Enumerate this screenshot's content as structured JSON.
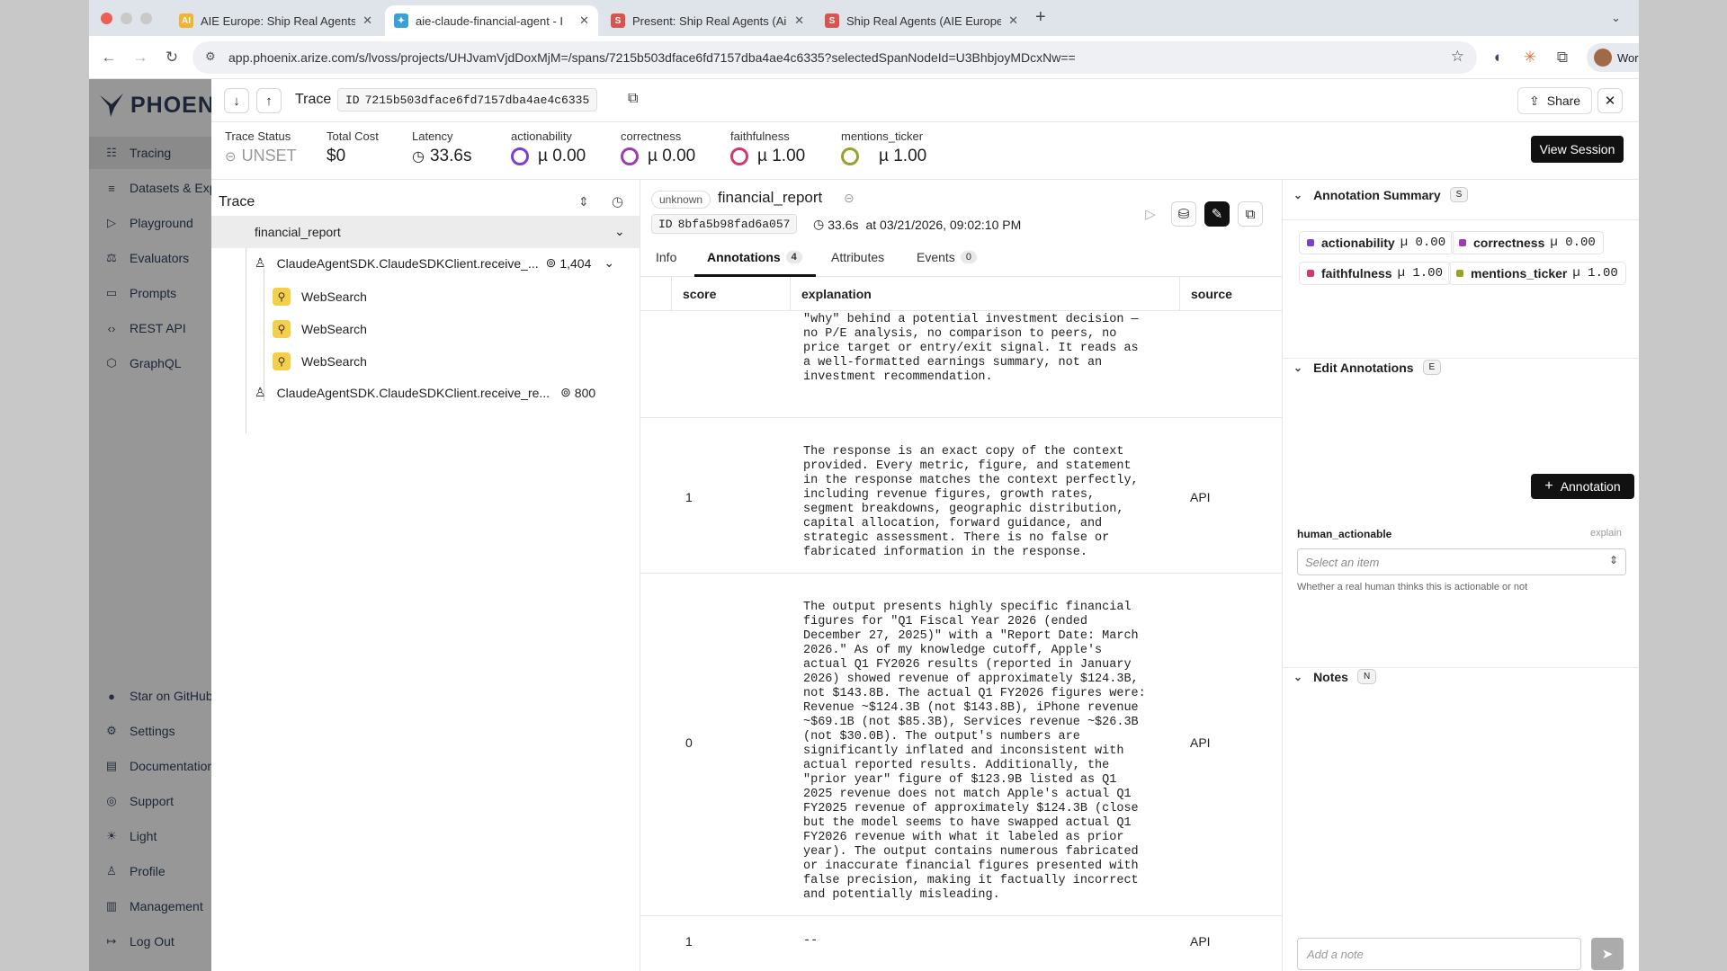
{
  "browser": {
    "tabs": [
      {
        "title": "AIE Europe: Ship Real Agents",
        "favicon": "AI",
        "fav_color": "#f0b431"
      },
      {
        "title": "aie-claude-financial-agent - I",
        "favicon": "✦",
        "fav_color": "#3aa0d8"
      },
      {
        "title": "Present: Ship Real Agents (Ai",
        "favicon": "S",
        "fav_color": "#d9534f"
      },
      {
        "title": "Ship Real Agents (AIE Europe",
        "favicon": "S",
        "fav_color": "#d9534f"
      }
    ],
    "new_tab": "+",
    "url": "app.phoenix.arize.com/s/lvoss/projects/UHJvamVjdDoxMjM=/spans/7215b503dface6fd7157dba4ae4c6335?selectedSpanNodeId=U3BhbjoyMDcxNw==",
    "profile": "Work"
  },
  "sidebar": {
    "logo": "PHOENIX",
    "items": [
      {
        "label": "Tracing",
        "icon": "tracing-icon",
        "glyph": "☷"
      },
      {
        "label": "Datasets & Experiments",
        "icon": "datasets-icon",
        "glyph": "≡"
      },
      {
        "label": "Playground",
        "icon": "playground-icon",
        "glyph": "▷"
      },
      {
        "label": "Evaluators",
        "icon": "evaluators-icon",
        "glyph": "⚖"
      },
      {
        "label": "Prompts",
        "icon": "prompts-icon",
        "glyph": "▭"
      },
      {
        "label": "REST API",
        "icon": "rest-api-icon",
        "glyph": "‹›"
      },
      {
        "label": "GraphQL",
        "icon": "graphql-icon",
        "glyph": "⬡"
      }
    ],
    "bottom_items": [
      {
        "label": "Star on GitHub",
        "icon": "github-icon",
        "glyph": "●"
      },
      {
        "label": "Settings",
        "icon": "settings-icon",
        "glyph": "⚙"
      },
      {
        "label": "Documentation",
        "icon": "documentation-icon",
        "glyph": "▤"
      },
      {
        "label": "Support",
        "icon": "support-icon",
        "glyph": "◎"
      },
      {
        "label": "Light",
        "icon": "light-icon",
        "glyph": "☀"
      },
      {
        "label": "Profile",
        "icon": "profile-icon",
        "glyph": "♙"
      },
      {
        "label": "Management",
        "icon": "management-icon",
        "glyph": "▥"
      },
      {
        "label": "Log Out",
        "icon": "logout-icon",
        "glyph": "↦"
      }
    ]
  },
  "trace_header": {
    "title": "Trace",
    "id_label": "ID",
    "id": "7215b503dface6fd7157dba4ae4c6335",
    "share": "Share"
  },
  "stats": {
    "trace_status": {
      "label": "Trace Status",
      "value": "UNSET"
    },
    "total_cost": {
      "label": "Total Cost",
      "value": "$0"
    },
    "latency": {
      "label": "Latency",
      "value": "33.6s"
    },
    "metrics": [
      {
        "label": "actionability",
        "value": "µ 0.00",
        "color": "#7b3fd1"
      },
      {
        "label": "correctness",
        "value": "µ 0.00",
        "color": "#a13bb5"
      },
      {
        "label": "faithfulness",
        "value": "µ 1.00",
        "color": "#d23a6a"
      },
      {
        "label": "mentions_ticker",
        "value": "µ 1.00",
        "color": "#9aa12a"
      }
    ],
    "view_session": "View Session"
  },
  "trace_tree": {
    "title": "Trace",
    "root": "financial_report",
    "children": [
      {
        "label": "ClaudeAgentSDK.ClaudeSDKClient.receive_...",
        "tokens": "1,404"
      },
      {
        "label": "WebSearch"
      },
      {
        "label": "WebSearch"
      },
      {
        "label": "WebSearch"
      },
      {
        "label": "ClaudeAgentSDK.ClaudeSDKClient.receive_re...",
        "tokens": "800"
      }
    ]
  },
  "span": {
    "kind": "unknown",
    "name": "financial_report",
    "id_label": "ID",
    "id": "8bfa5b98fad6a057",
    "latency": "33.6s",
    "timestamp": "at 03/21/2026, 09:02:10 PM",
    "tabs": [
      {
        "label": "Info",
        "count": ""
      },
      {
        "label": "Annotations",
        "count": "4"
      },
      {
        "label": "Attributes",
        "count": ""
      },
      {
        "label": "Events",
        "count": "0"
      }
    ]
  },
  "annotations_table": {
    "headers": [
      "score",
      "explanation",
      "source"
    ],
    "rows": [
      {
        "score": "",
        "source": "",
        "explanation": "performance positively but offers no actionable\n\"why\" behind a potential investment decision —\nno P/E analysis, no comparison to peers, no\nprice target or entry/exit signal. It reads as\na well-formatted earnings summary, not an\ninvestment recommendation."
      },
      {
        "score": "1",
        "source": "API",
        "explanation": "The response is an exact copy of the context\nprovided. Every metric, figure, and statement\nin the response matches the context perfectly,\nincluding revenue figures, growth rates,\nsegment breakdowns, geographic distribution,\ncapital allocation, forward guidance, and\nstrategic assessment. There is no false or\nfabricated information in the response."
      },
      {
        "score": "0",
        "source": "API",
        "explanation": "The output presents highly specific financial\nfigures for \"Q1 Fiscal Year 2026 (ended\nDecember 27, 2025)\" with a \"Report Date: March\n2026.\" As of my knowledge cutoff, Apple's\nactual Q1 FY2026 results (reported in January\n2026) showed revenue of approximately $124.3B,\nnot $143.8B. The actual Q1 FY2026 figures were:\nRevenue ~$124.3B (not $143.8B), iPhone revenue\n~$69.1B (not $85.3B), Services revenue ~$26.3B\n(not $30.0B). The output's numbers are\nsignificantly inflated and inconsistent with\nactual reported results. Additionally, the\n\"prior year\" figure of $123.9B listed as Q1\n2025 revenue does not match Apple's actual Q1\nFY2025 revenue of approximately $124.3B (close\nbut the model seems to have swapped actual Q1\nFY2026 revenue with what it labeled as prior\nyear). The output contains numerous fabricated\nor inaccurate financial figures presented with\nfalse precision, making it factually incorrect\nand potentially misleading."
      },
      {
        "score": "1",
        "source": "API",
        "explanation": "--"
      }
    ]
  },
  "annotation_summary": {
    "title": "Annotation Summary",
    "shortcut": "S",
    "chips": [
      {
        "name": "actionability",
        "value": "µ 0.00",
        "color": "#7b3fd1"
      },
      {
        "name": "correctness",
        "value": "µ 0.00",
        "color": "#a13bb5"
      },
      {
        "name": "faithfulness",
        "value": "µ 1.00",
        "color": "#d23a6a"
      },
      {
        "name": "mentions_ticker",
        "value": "µ 1.00",
        "color": "#9aa12a"
      }
    ]
  },
  "edit_annotations": {
    "title": "Edit Annotations",
    "shortcut": "E",
    "add_button": "Annotation",
    "field_label": "human_actionable",
    "explain": "explain",
    "select_placeholder": "Select an item",
    "help": "Whether a real human thinks this is actionable or not"
  },
  "notes": {
    "title": "Notes",
    "shortcut": "N",
    "placeholder": "Add a note"
  }
}
